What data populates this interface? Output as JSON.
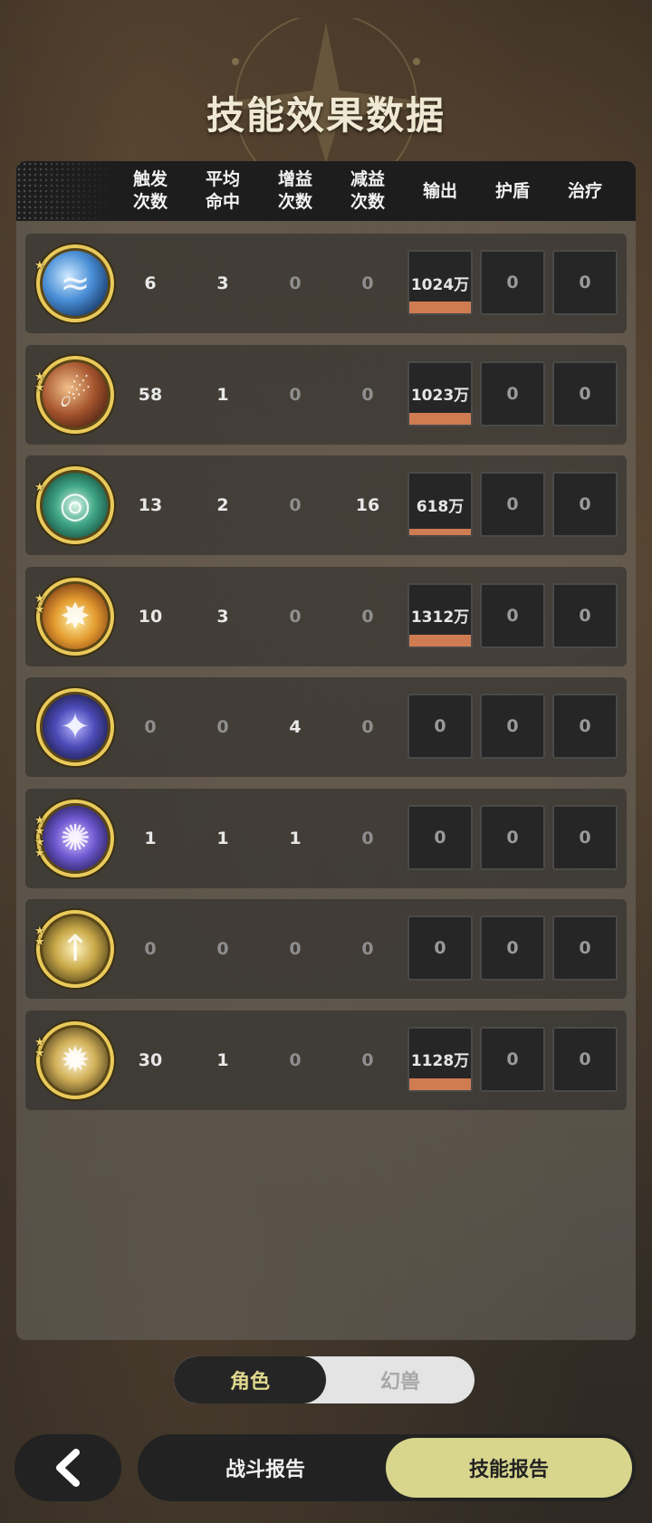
{
  "title": "技能效果数据",
  "columns": [
    "触发\n次数",
    "平均\n命中",
    "增益\n次数",
    "减益\n次数",
    "输出",
    "护盾",
    "治疗"
  ],
  "colors": {
    "accent": "#d8d68d",
    "bar": "#cf7c52",
    "icon_ring": "#e9c95a"
  },
  "rows": [
    {
      "icon": "water-wave-skill-icon",
      "stars": 1,
      "trigger": "6",
      "avg_hit": "3",
      "buff": "0",
      "debuff": "0",
      "output": "1024万",
      "output_level": 1.0,
      "shield": "0",
      "heal": "0"
    },
    {
      "icon": "meteor-skill-icon",
      "stars": 2,
      "trigger": "58",
      "avg_hit": "1",
      "buff": "0",
      "debuff": "0",
      "output": "1023万",
      "output_level": 1.0,
      "shield": "0",
      "heal": "0"
    },
    {
      "icon": "wind-vortex-skill-icon",
      "stars": 1,
      "trigger": "13",
      "avg_hit": "2",
      "buff": "0",
      "debuff": "16",
      "output": "618万",
      "output_level": 1.0,
      "shield": "0",
      "heal": "0"
    },
    {
      "icon": "explosion-skill-icon",
      "stars": 2,
      "trigger": "10",
      "avg_hit": "3",
      "buff": "0",
      "debuff": "0",
      "output": "1312万",
      "output_level": 1.0,
      "shield": "0",
      "heal": "0"
    },
    {
      "icon": "starlight-skill-icon",
      "stars": 0,
      "trigger": "0",
      "avg_hit": "0",
      "buff": "4",
      "debuff": "0",
      "output": "0",
      "output_level": 0,
      "shield": "0",
      "heal": "0"
    },
    {
      "icon": "arcane-clock-skill-icon",
      "stars": 4,
      "trigger": "1",
      "avg_hit": "1",
      "buff": "1",
      "debuff": "0",
      "output": "0",
      "output_level": 0,
      "shield": "0",
      "heal": "0"
    },
    {
      "icon": "golden-arrow-skill-icon",
      "stars": 2,
      "trigger": "0",
      "avg_hit": "0",
      "buff": "0",
      "debuff": "0",
      "output": "0",
      "output_level": 0,
      "shield": "0",
      "heal": "0"
    },
    {
      "icon": "golden-burst-skill-icon",
      "stars": 2,
      "trigger": "30",
      "avg_hit": "1",
      "buff": "0",
      "debuff": "0",
      "output": "1128万",
      "output_level": 1.0,
      "shield": "0",
      "heal": "0"
    }
  ],
  "toggle": {
    "active": "角色",
    "inactive": "幻兽"
  },
  "bottom_nav": {
    "battle_report": "战斗报告",
    "skill_report": "技能报告"
  }
}
